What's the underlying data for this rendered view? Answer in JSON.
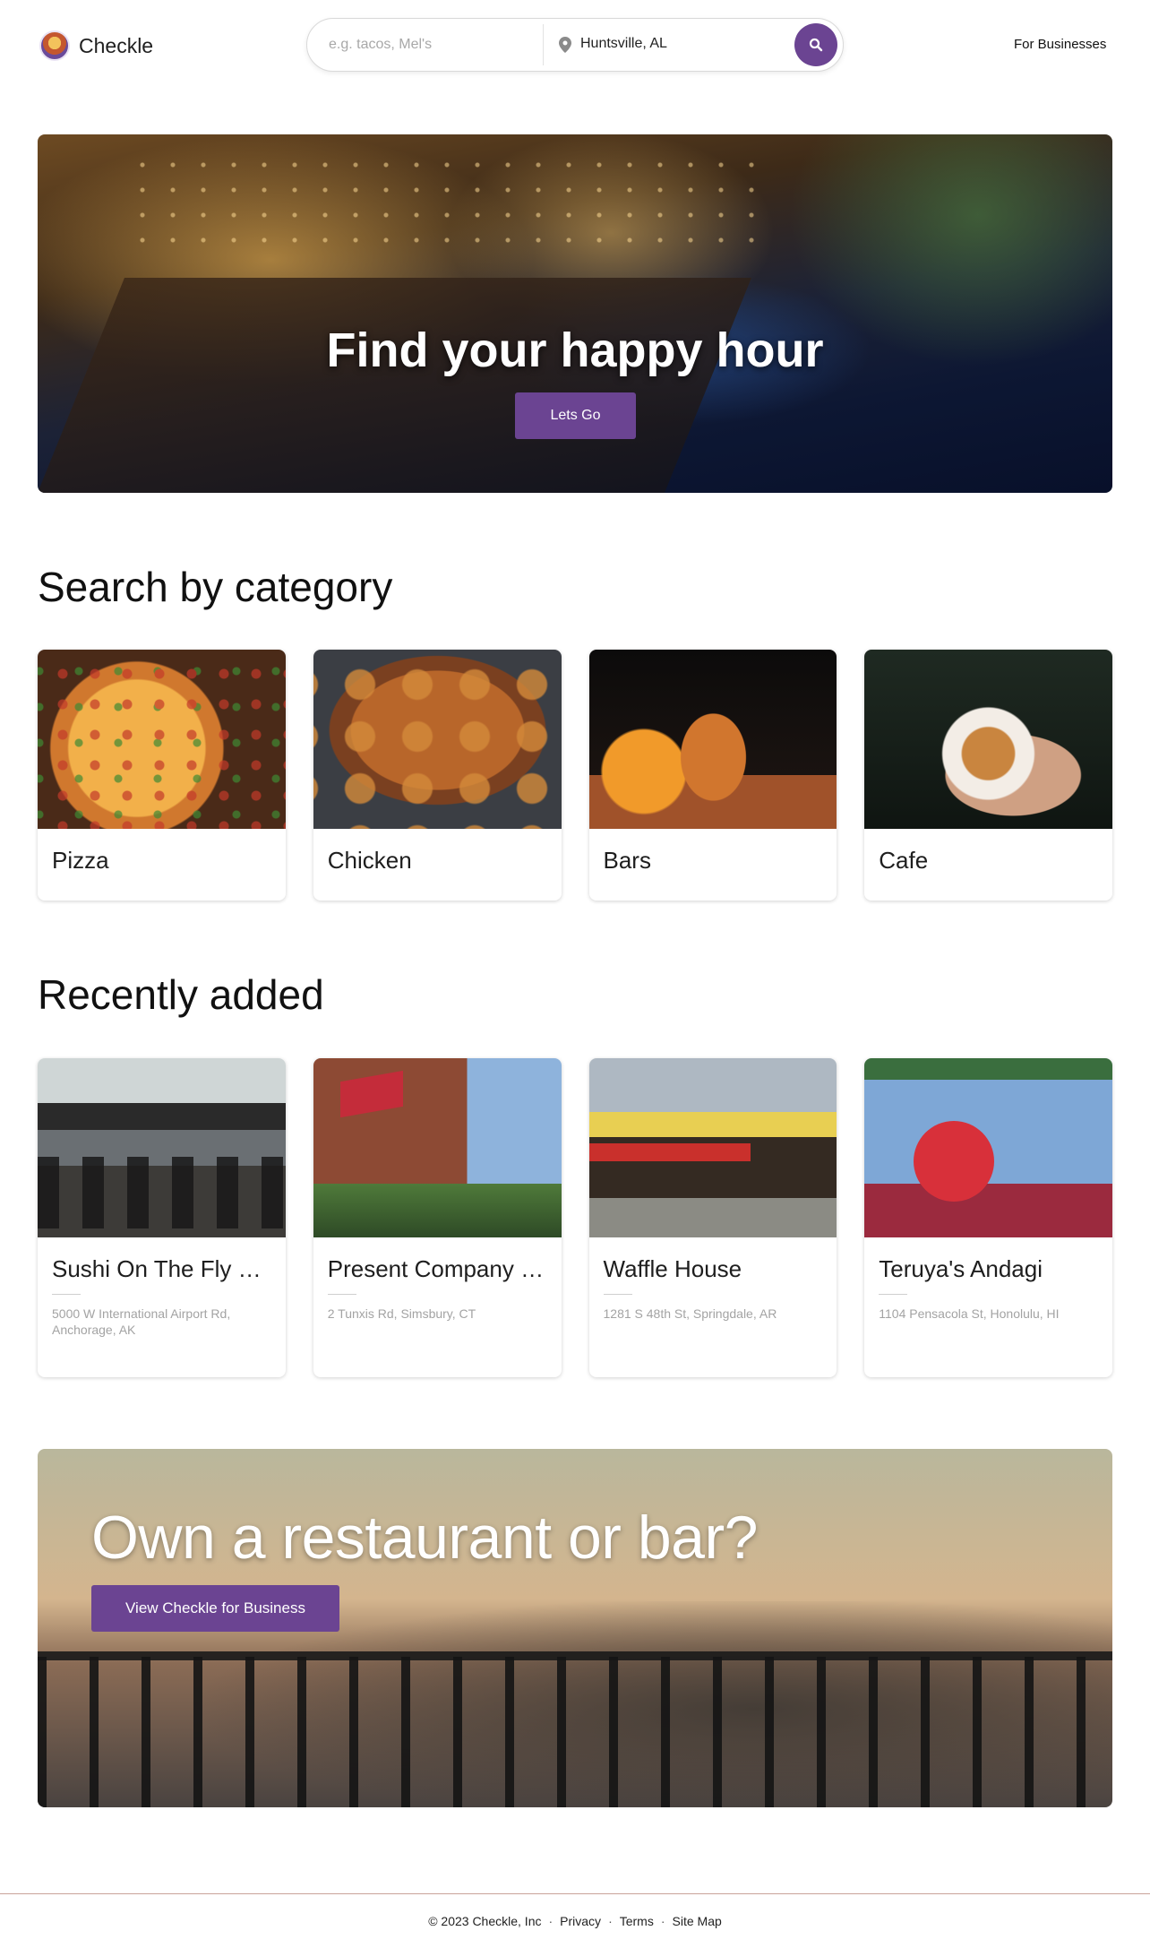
{
  "header": {
    "logo_text": "Checkle",
    "search_placeholder": "e.g. tacos, Mel's",
    "location": "Huntsville, AL",
    "for_businesses": "For Businesses"
  },
  "hero": {
    "title": "Find your happy hour",
    "button": "Lets Go"
  },
  "categories": {
    "title": "Search by category",
    "items": [
      {
        "label": "Pizza"
      },
      {
        "label": "Chicken"
      },
      {
        "label": "Bars"
      },
      {
        "label": "Cafe"
      }
    ]
  },
  "recent": {
    "title": "Recently added",
    "items": [
      {
        "name": "Sushi On The Fly Cu...",
        "address": "5000 W International Airport Rd, Anchorage, AK"
      },
      {
        "name": "Present Company R...",
        "address": "2 Tunxis Rd, Simsbury, CT"
      },
      {
        "name": "Waffle House",
        "address": "1281 S 48th St, Springdale, AR"
      },
      {
        "name": "Teruya's Andagi",
        "address": "1104 Pensacola St, Honolulu, HI"
      }
    ]
  },
  "business": {
    "title": "Own a restaurant or bar?",
    "button": "View Checkle for Business"
  },
  "footer": {
    "copyright": "© 2023 Checkle, Inc",
    "privacy": "Privacy",
    "terms": "Terms",
    "sitemap": "Site Map"
  },
  "colors": {
    "accent": "#6b4492"
  },
  "icons": {
    "search": "search-icon",
    "location": "location-pin-icon",
    "logo": "checkle-logo-icon"
  }
}
